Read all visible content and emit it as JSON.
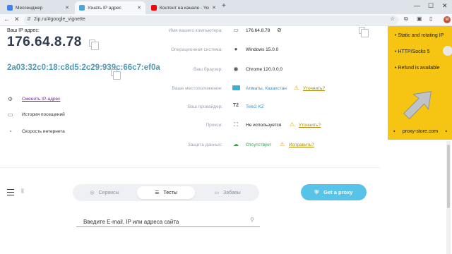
{
  "browser": {
    "tabs": [
      {
        "label": "Мессенджер",
        "favicon_color": "#3b82f6"
      },
      {
        "label": "Узнать IP адрес",
        "favicon_color": "#4aa8d8"
      },
      {
        "label": "Контент на канале - YouTube",
        "favicon_color": "#ff0000"
      }
    ],
    "url": "2ip.ru/#google_vignette",
    "avatar_letter": "M"
  },
  "ip_panel": {
    "ip_label": "Ваш IP адрес:",
    "ip_value": "176.64.8.78",
    "ipv6_value": "2a03:32c0:18:c8d5:2c29:939c:66c7:ef0a",
    "menu": [
      {
        "icon": "settings-icon",
        "label": "Сменить IP-адрес"
      },
      {
        "icon": "history-icon",
        "label": "История посещений"
      },
      {
        "icon": "speedometer-icon",
        "label": "Скорость интернета"
      }
    ]
  },
  "info": {
    "rows": [
      {
        "label": "Имя вашего компьютера:",
        "icon": "monitor-icon",
        "value": "176.64.8.78"
      },
      {
        "label": "Операционная система:",
        "icon": "apple-icon",
        "value": "Windows 15.0.0"
      },
      {
        "label": "Ваш браузер:",
        "icon": "chrome-icon",
        "value": "Chrome 120.0.0.0"
      },
      {
        "label": "Ваше местоположение:",
        "icon": "flag-icon",
        "value": "Алматы, Казахстан",
        "link": "Уточнить?"
      },
      {
        "label": "Ваш провайдер:",
        "icon": "provider-icon",
        "value": "Tele2 KZ"
      },
      {
        "label": "Прокси:",
        "icon": "network-icon",
        "value": "Не используется",
        "link": "Уточнить?"
      },
      {
        "label": "Защита данных:",
        "icon": "cloud-icon",
        "value": "Отсутствует",
        "link": "Исправить?"
      }
    ]
  },
  "ad": {
    "items": [
      "• Static and rotating IP",
      "• HTTP/Socks 5",
      "• Refund is available"
    ],
    "footer": "proxy-store.com",
    "accent": "#f6c412"
  },
  "nav": {
    "segments": [
      "Сервисы",
      "Тесты",
      "Забавы"
    ],
    "cta": "Get a proxy",
    "cta_color": "#57c3e8",
    "search_placeholder": "Введите E-mail, IP или адреса сайта"
  }
}
